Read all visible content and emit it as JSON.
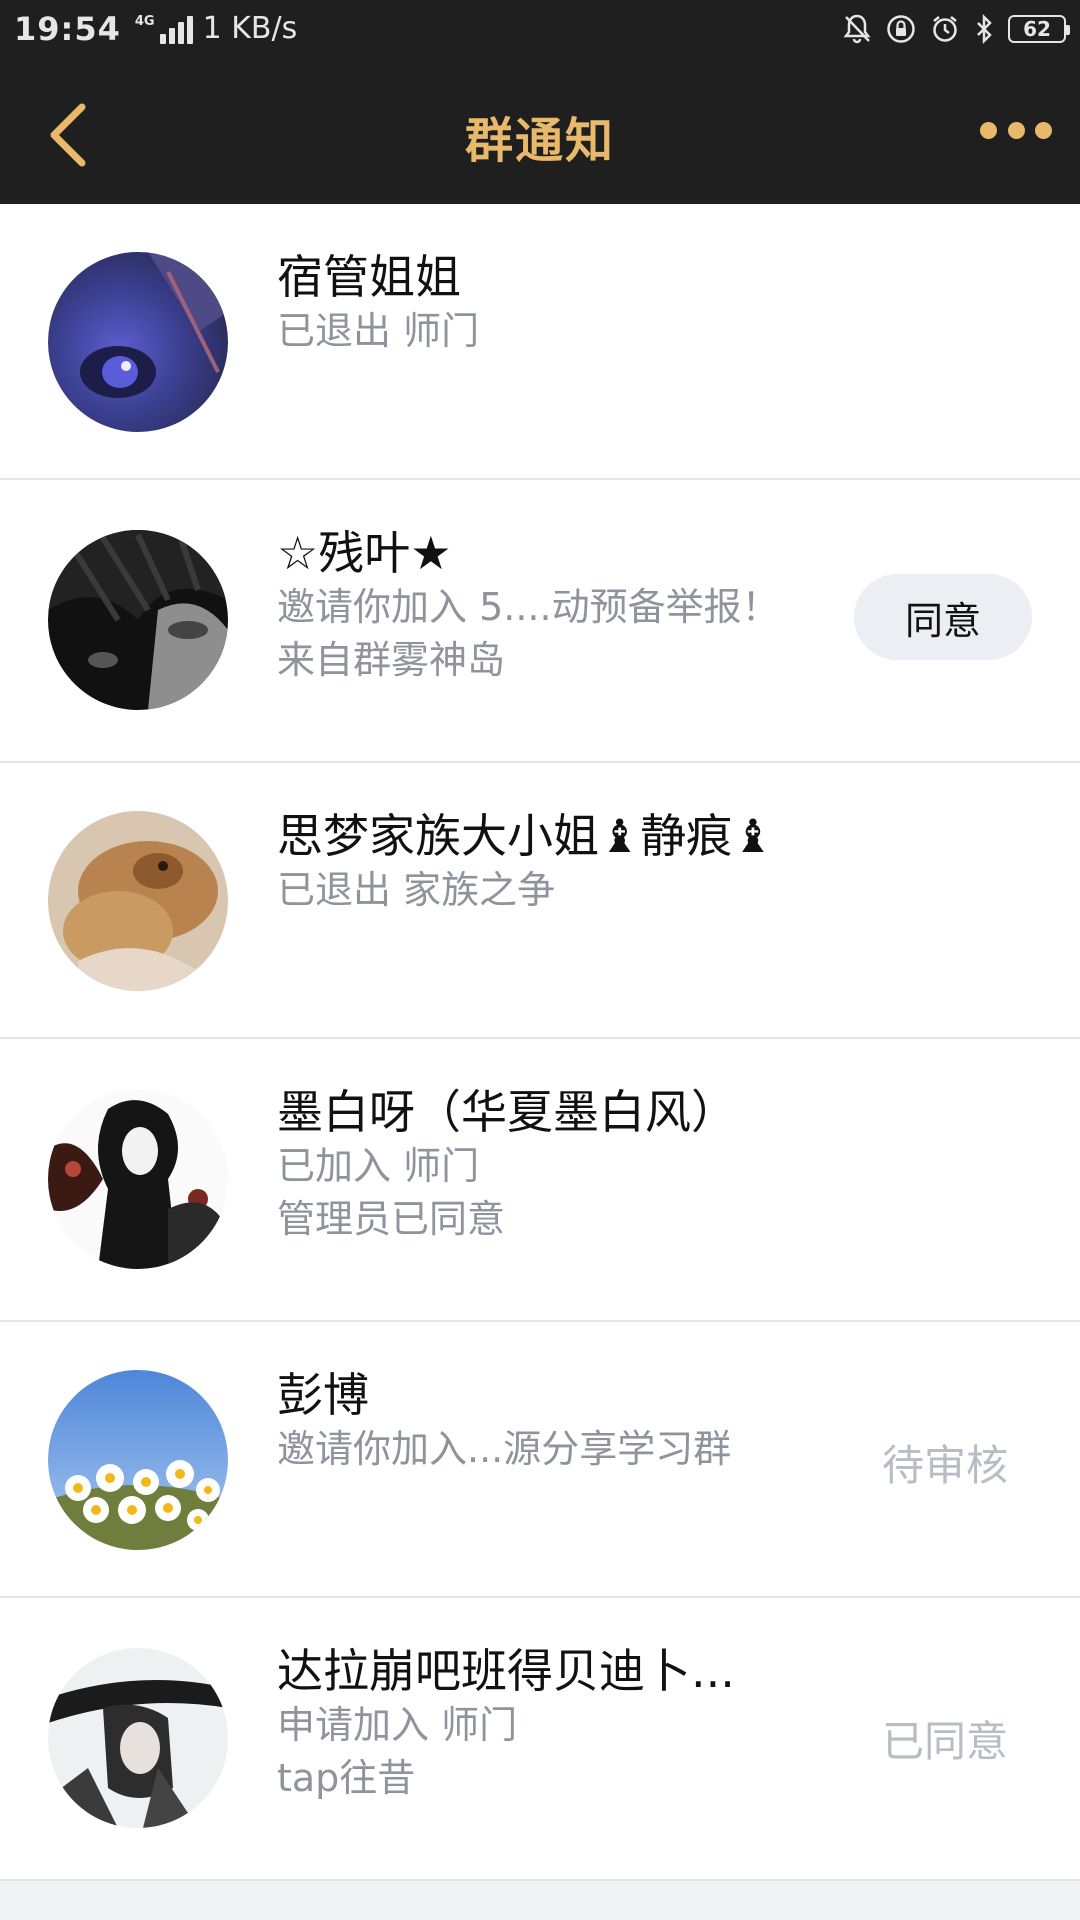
{
  "status_bar": {
    "time": "19:54",
    "network": "4G",
    "speed": "1 KB/s",
    "battery": "62",
    "icons": [
      "mute-bell-icon",
      "lock-rotation-icon",
      "alarm-icon",
      "bluetooth-icon"
    ]
  },
  "nav": {
    "title": "群通知",
    "back_icon": "chevron-left-icon",
    "more_icon": "more-dots-icon",
    "accent_color": "#e8b96a"
  },
  "notifications": [
    {
      "name": "宿管姐姐",
      "line1": "已退出 师门",
      "line2": "",
      "action": ""
    },
    {
      "name": "☆残叶★",
      "line1": "邀请你加入 5....动预备举报！",
      "line2": "来自群雾神岛",
      "action": "同意"
    },
    {
      "name": "思梦家族大小姐♝静痕♝",
      "line1": "已退出 家族之争",
      "line2": "",
      "action": ""
    },
    {
      "name": "墨白呀（华夏墨白风）",
      "line1": "已加入 师门",
      "line2": "管理员已同意",
      "action": ""
    },
    {
      "name": "彭博",
      "line1": "邀请你加入...源分享学习群",
      "line2": "",
      "action": "待审核"
    },
    {
      "name": "达拉崩吧班得贝迪卜...",
      "line1": "申请加入 师门",
      "line2": "tap往昔",
      "action": "已同意"
    }
  ]
}
